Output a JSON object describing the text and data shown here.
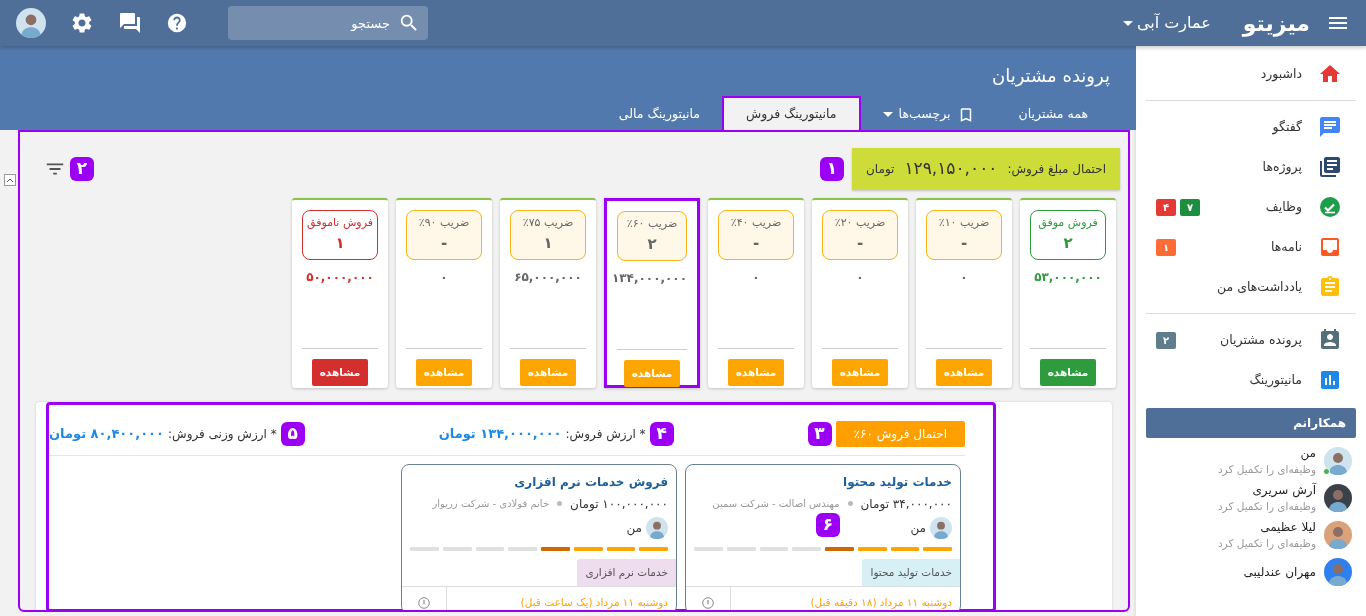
{
  "topbar": {
    "brand": "میزیتو",
    "workspace": "عمارت آبی",
    "search_placeholder": "جستجو"
  },
  "sidebar": {
    "groups": [
      [
        {
          "label": "داشبورد"
        }
      ],
      [
        {
          "label": "گفتگو"
        },
        {
          "label": "پروژه‌ها"
        },
        {
          "label": "وظایف",
          "badges": [
            {
              "text": "۷",
              "color": "#1e8e3e"
            },
            {
              "text": "۴",
              "color": "#e53935"
            }
          ]
        },
        {
          "label": "نامه‌ها",
          "badges": [
            {
              "text": "۱",
              "color": "#ff6b35"
            }
          ]
        },
        {
          "label": "یادداشت‌های من"
        }
      ],
      [
        {
          "label": "پرونده مشتریان",
          "badges": [
            {
              "text": "۲",
              "color": "#607d8b"
            }
          ]
        },
        {
          "label": "مانیتورینگ"
        }
      ]
    ],
    "colleagues_title": "همکارانم",
    "colleagues": [
      {
        "name": "من",
        "status": "وظیفه‌ای را تکمیل کرد",
        "online": true
      },
      {
        "name": "آرش سریری",
        "status": "وظیفه‌ای را تکمیل کرد",
        "online": false
      },
      {
        "name": "لیلا عظیمی",
        "status": "وظیفه‌ای را تکمیل کرد",
        "online": false
      },
      {
        "name": "مهران عندلیبی",
        "online": false
      }
    ]
  },
  "page": {
    "title": "پرونده مشتریان",
    "tabs": [
      {
        "label": "همه مشتریان",
        "kind": "plain",
        "selected": false
      },
      {
        "label": "برچسب‌ها",
        "kind": "dropdown",
        "selected": false
      },
      {
        "label": "مانیتورینگ فروش",
        "kind": "plain",
        "selected": true
      },
      {
        "label": "مانیتورینگ مالی",
        "kind": "plain",
        "selected": false
      }
    ]
  },
  "summary": {
    "marker": "۱",
    "label": "احتمال مبلغ فروش:",
    "amount": "۱۲۹,۱۵۰,۰۰۰",
    "unit": "تومان"
  },
  "filter_marker": "۲",
  "stages": [
    {
      "kind": "won",
      "title": "فروش موفق",
      "count": "۲",
      "amount": "۵۳,۰۰۰,۰۰۰",
      "button": "مشاهده",
      "highlighted": false
    },
    {
      "kind": "open",
      "title": "ضریب ۱۰٪",
      "count": "-",
      "amount": "۰",
      "button": "مشاهده",
      "highlighted": false
    },
    {
      "kind": "open",
      "title": "ضریب ۲۰٪",
      "count": "-",
      "amount": "۰",
      "button": "مشاهده",
      "highlighted": false
    },
    {
      "kind": "open",
      "title": "ضریب ۴۰٪",
      "count": "-",
      "amount": "۰",
      "button": "مشاهده",
      "highlighted": false
    },
    {
      "kind": "open",
      "title": "ضریب ۶۰٪",
      "count": "۲",
      "amount": "۱۳۴,۰۰۰,۰۰۰",
      "button": "مشاهده",
      "highlighted": true
    },
    {
      "kind": "open",
      "title": "ضریب ۷۵٪",
      "count": "۱",
      "amount": "۶۵,۰۰۰,۰۰۰",
      "button": "مشاهده",
      "highlighted": false
    },
    {
      "kind": "open",
      "title": "ضریب ۹۰٪",
      "count": "-",
      "amount": "۰",
      "button": "مشاهده",
      "highlighted": false
    },
    {
      "kind": "lost",
      "title": "فروش ناموفق",
      "count": "۱",
      "amount": "۵۰,۰۰۰,۰۰۰",
      "button": "مشاهده",
      "highlighted": false
    }
  ],
  "detail": {
    "probability_marker": "۳",
    "probability": "احتمال فروش ۶۰٪",
    "value_marker": "۴",
    "value_label": "* ارزش فروش:",
    "value": "۱۳۴,۰۰۰,۰۰۰ تومان",
    "weighted_marker": "۵",
    "weighted_label": "* ارزش وزنی فروش:",
    "weighted": "۸۰,۴۰۰,۰۰۰ تومان",
    "deals": [
      {
        "title": "خدمات تولید محتوا",
        "amount": "۳۴,۰۰۰,۰۰۰ تومان",
        "contact": "مهندس اصالت - شرکت سمین",
        "owner": "من",
        "level": 0.5,
        "tag": "خدمات تولید محتوا",
        "color": "#d7f0f5",
        "date": "دوشنبه ۱۱ مرداد (۱۸ دقیقه قبل)",
        "marker": "۶"
      },
      {
        "title": "فروش خدمات نرم افزاری",
        "amount": "۱۰۰,۰۰۰,۰۰۰ تومان",
        "contact": "خانم فولادی - شرکت زریوار",
        "owner": "من",
        "level": 0.5,
        "tag": "خدمات نرم افزاری",
        "color": "#eedcef",
        "date": "دوشنبه ۱۱ مرداد (یک ساعت قبل)"
      }
    ]
  }
}
